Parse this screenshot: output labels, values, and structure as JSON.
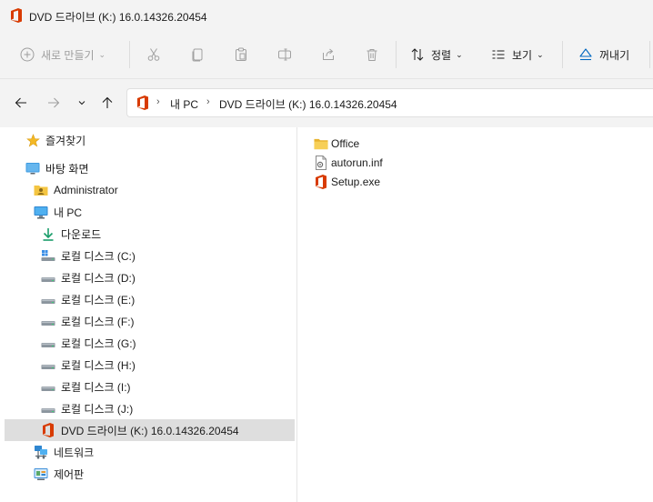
{
  "window": {
    "title": "DVD 드라이브 (K:) 16.0.14326.20454"
  },
  "commandbar": {
    "new_label": "새로 만들기",
    "sort_label": "정렬",
    "view_label": "보기",
    "eject_label": "꺼내기"
  },
  "address": {
    "crumbs": [
      "내 PC",
      "DVD 드라이브 (K:) 16.0.14326.20454"
    ]
  },
  "sidebar": {
    "items": [
      {
        "label": "즐겨찾기",
        "icon": "star-icon"
      },
      {
        "label": "바탕 화면",
        "icon": "desktop-icon"
      },
      {
        "label": "Administrator",
        "icon": "user-folder-icon"
      },
      {
        "label": "내 PC",
        "icon": "computer-icon"
      },
      {
        "label": "다운로드",
        "icon": "download-icon"
      },
      {
        "label": "로컬 디스크 (C:)",
        "icon": "system-drive-icon"
      },
      {
        "label": "로컬 디스크 (D:)",
        "icon": "drive-icon"
      },
      {
        "label": "로컬 디스크 (E:)",
        "icon": "drive-icon"
      },
      {
        "label": "로컬 디스크 (F:)",
        "icon": "drive-icon"
      },
      {
        "label": "로컬 디스크 (G:)",
        "icon": "drive-icon"
      },
      {
        "label": "로컬 디스크 (H:)",
        "icon": "drive-icon"
      },
      {
        "label": "로컬 디스크 (I:)",
        "icon": "drive-icon"
      },
      {
        "label": "로컬 디스크 (J:)",
        "icon": "drive-icon"
      },
      {
        "label": "DVD 드라이브 (K:) 16.0.14326.20454",
        "icon": "office-icon",
        "selected": true
      },
      {
        "label": "네트워크",
        "icon": "network-icon"
      },
      {
        "label": "제어판",
        "icon": "control-panel-icon"
      }
    ]
  },
  "files": [
    {
      "name": "Office",
      "icon": "folder-icon"
    },
    {
      "name": "autorun.inf",
      "icon": "settings-file-icon"
    },
    {
      "name": "Setup.exe",
      "icon": "office-icon"
    }
  ],
  "colors": {
    "office_orange": "#d83b01",
    "folder_yellow": "#f4c542",
    "accent": "#0067c0"
  }
}
